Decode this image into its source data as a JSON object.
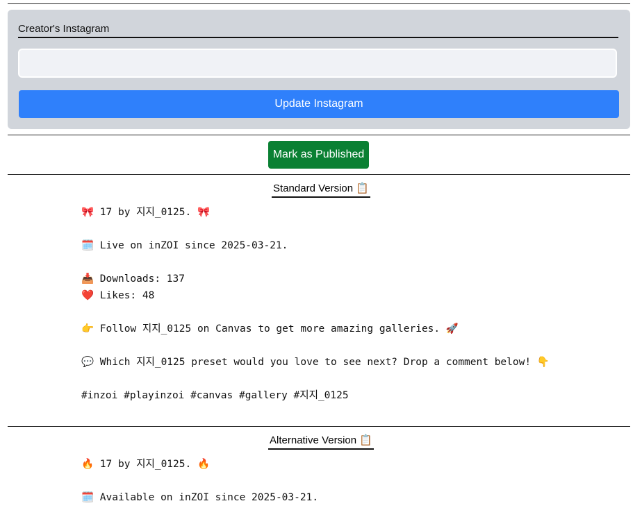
{
  "instagram_section": {
    "label": "Creator's Instagram",
    "input_value": "",
    "input_placeholder": "",
    "update_button": "Update Instagram"
  },
  "publish_button": "Mark as Published",
  "standard": {
    "title": "Standard Version",
    "title_icon": "📋",
    "lines": {
      "title_line": "🎀 17 by 지지_0125. 🎀",
      "live_line": "🗓️ Live on inZOI since 2025-03-21.",
      "downloads_line": "📥 Downloads: 137",
      "likes_line": "❤️ Likes: 48",
      "follow_line": "👉 Follow 지지_0125 on Canvas to get more amazing galleries. 🚀",
      "question_line": "💬 Which 지지_0125 preset would you love to see next? Drop a comment below! 👇",
      "hashtags_line": "#inzoi #playinzoi #canvas #gallery #지지_0125"
    }
  },
  "alternative": {
    "title": "Alternative Version",
    "title_icon": "📋",
    "lines": {
      "title_line": "🔥 17 by 지지_0125. 🔥",
      "available_line": "🗓️ Available on inZOI since 2025-03-21."
    }
  }
}
